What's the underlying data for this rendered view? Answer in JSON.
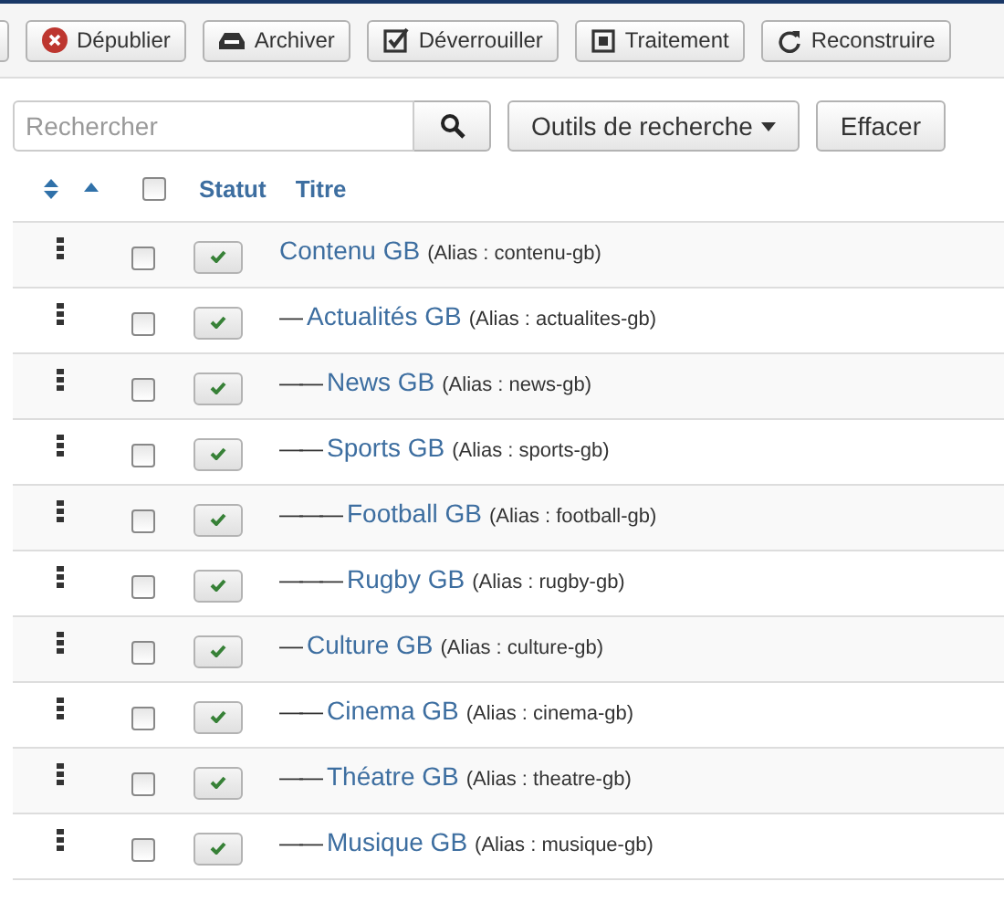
{
  "toolbar": [
    {
      "kind": "unpublish",
      "label": "Dépublier"
    },
    {
      "kind": "archive",
      "label": "Archiver"
    },
    {
      "kind": "unlock",
      "label": "Déverrouiller"
    },
    {
      "kind": "batch",
      "label": "Traitement"
    },
    {
      "kind": "rebuild",
      "label": "Reconstruire"
    }
  ],
  "search": {
    "placeholder": "Rechercher"
  },
  "search_tools": "Outils de recherche",
  "clear": "Effacer",
  "table": {
    "select_all_checked": false,
    "columns": [
      "Statut",
      "Titre"
    ],
    "rows": [
      {
        "prefix": "",
        "title": "Contenu GB",
        "alias": "(Alias : contenu-gb)",
        "checked": false,
        "published": true,
        "children": [
          {
            "prefix": "—",
            "title": "Actualités GB",
            "alias": "(Alias : actualites-gb)",
            "checked": false,
            "published": true,
            "children": [
              {
                "prefix": "——",
                "title": "News GB",
                "alias": "(Alias : news-gb)",
                "checked": false,
                "published": true
              },
              {
                "prefix": "——",
                "title": "Sports GB",
                "alias": "(Alias : sports-gb)",
                "checked": false,
                "published": true,
                "children": [
                  {
                    "prefix": "———",
                    "title": "Football GB",
                    "alias": "(Alias : football-gb)",
                    "checked": false,
                    "published": true
                  },
                  {
                    "prefix": "———",
                    "title": "Rugby GB",
                    "alias": "(Alias : rugby-gb)",
                    "checked": false,
                    "published": true
                  }
                ]
              }
            ]
          },
          {
            "prefix": "—",
            "title": "Culture GB",
            "alias": "(Alias : culture-gb)",
            "checked": false,
            "published": true,
            "children": [
              {
                "prefix": "——",
                "title": "Cinema GB",
                "alias": "(Alias : cinema-gb)",
                "checked": false,
                "published": true
              },
              {
                "prefix": "——",
                "title": "Théatre GB",
                "alias": "(Alias : theatre-gb)",
                "checked": false,
                "published": true
              },
              {
                "prefix": "——",
                "title": "Musique GB",
                "alias": "(Alias : musique-gb)",
                "checked": false,
                "published": true
              }
            ]
          }
        ]
      }
    ]
  }
}
